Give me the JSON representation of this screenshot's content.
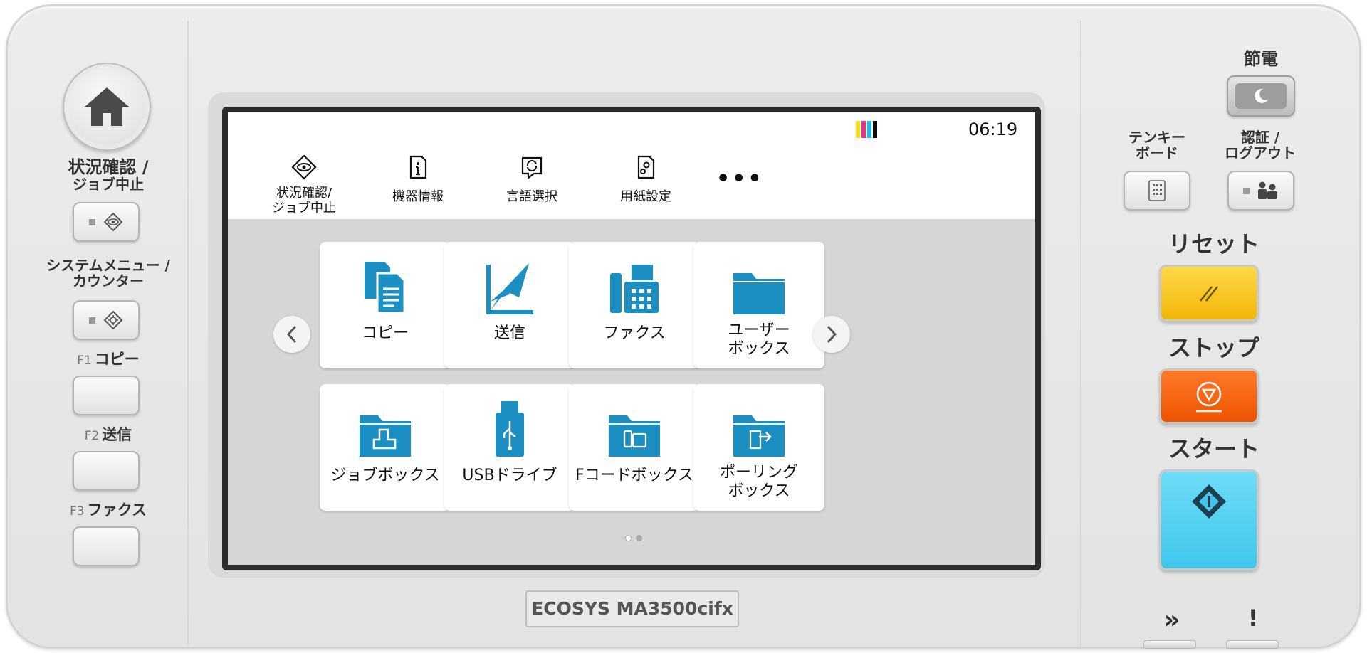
{
  "left": {
    "status_label_1": "状況確認 /",
    "status_label_2": "ジョブ中止",
    "sysmenu_label_1": "システムメニュー /",
    "sysmenu_label_2": "カウンター",
    "f1_key": "F1",
    "f1_label": "コピー",
    "f2_key": "F2",
    "f2_label": "送信",
    "f3_key": "F3",
    "f3_label": "ファクス"
  },
  "screen": {
    "clock": "06:19",
    "quick": [
      {
        "label": "状況確認/\nジョブ中止"
      },
      {
        "label": "機器情報"
      },
      {
        "label": "言語選択"
      },
      {
        "label": "用紙設定"
      }
    ],
    "more": "•••",
    "tiles": [
      {
        "label": "コピー"
      },
      {
        "label": "送信"
      },
      {
        "label": "ファクス"
      },
      {
        "label": "ユーザー\nボックス"
      },
      {
        "label": "ジョブボックス"
      },
      {
        "label": "USBドライブ"
      },
      {
        "label": "Fコードボックス"
      },
      {
        "label": "ポーリング\nボックス"
      }
    ],
    "page_indicator": {
      "current": 1,
      "total": 2
    }
  },
  "model": "ECOSYS MA3500cifx",
  "right": {
    "energy_label": "節電",
    "keypad_label_1": "テンキー",
    "keypad_label_2": "ボード",
    "auth_label_1": "認証 /",
    "auth_label_2": "ログアウト",
    "reset_label": "リセット",
    "stop_label": "ストップ",
    "start_label": "スタート",
    "processing_glyph": "»",
    "attention_glyph": "!"
  },
  "colors": {
    "tile_icon": "#1b8fc1",
    "reset": "#f6c213",
    "stop": "#f4620f",
    "start": "#54d3f3"
  },
  "ink_colors": [
    "#f4dc1e",
    "#e8357f",
    "#22b6e8",
    "#111111"
  ]
}
